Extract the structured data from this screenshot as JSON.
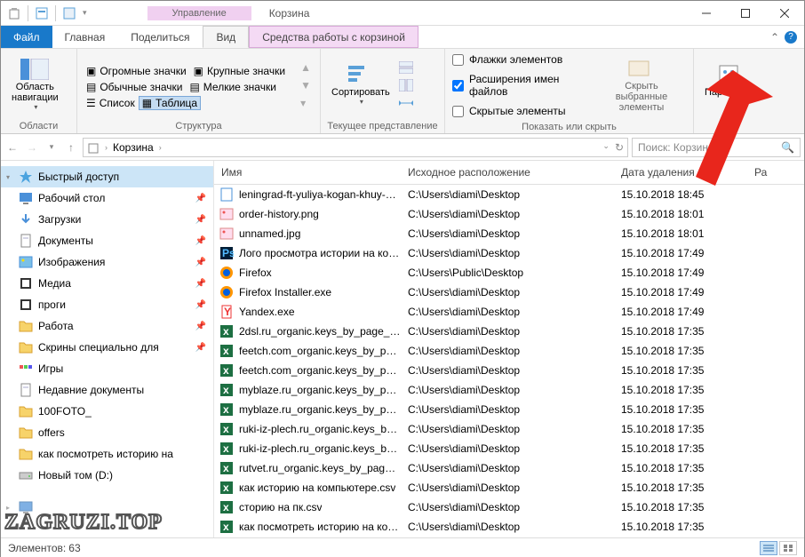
{
  "title": {
    "manage": "Управление",
    "app": "Корзина"
  },
  "tabs": {
    "file": "Файл",
    "home": "Главная",
    "share": "Поделиться",
    "view": "Вид",
    "tools": "Средства работы с корзиной"
  },
  "ribbon": {
    "nav_pane": "Область\nнавигации",
    "nav_group": "Области",
    "icons": {
      "huge": "Огромные значки",
      "large": "Крупные значки",
      "normal": "Обычные значки",
      "small": "Мелкие значки",
      "list": "Список",
      "table": "Таблица"
    },
    "struct_group": "Структура",
    "sort": "Сортировать",
    "view_group": "Текущее представление",
    "checks": {
      "flags": "Флажки элементов",
      "ext": "Расширения имен файлов",
      "hidden": "Скрытые элементы"
    },
    "hide_btn": "Скрыть выбранные\nэлементы",
    "show_group": "Показать или скрыть",
    "params": "Параметры"
  },
  "addr": {
    "root": "Корзина",
    "search_ph": "Поиск: Корзина"
  },
  "columns": {
    "name": "Имя",
    "loc": "Исходное расположение",
    "date": "Дата удаления",
    "r": "Ра"
  },
  "sidebar": {
    "quick": "Быстрый доступ",
    "items": [
      "Рабочий стол",
      "Загрузки",
      "Документы",
      "Изображения",
      "Медиа",
      "проги",
      "Работа",
      "Скрины специально для",
      "Игры",
      "Недавние документы",
      "100FOTO_",
      "offers",
      "как посмотреть историю на",
      "Новый том (D:)"
    ],
    "thispc_ru": "Этот компьютер"
  },
  "files": [
    {
      "ic": "doc",
      "name": "leningrad-ft-yuliya-kogan-khuy-m...",
      "loc": "C:\\Users\\diami\\Desktop",
      "date": "15.10.2018 18:45"
    },
    {
      "ic": "img",
      "name": "order-history.png",
      "loc": "C:\\Users\\diami\\Desktop",
      "date": "15.10.2018 18:01"
    },
    {
      "ic": "img",
      "name": "unnamed.jpg",
      "loc": "C:\\Users\\diami\\Desktop",
      "date": "15.10.2018 18:01"
    },
    {
      "ic": "ps",
      "name": "Лого просмотра истории на ком...",
      "loc": "C:\\Users\\diami\\Desktop",
      "date": "15.10.2018 17:49"
    },
    {
      "ic": "ff",
      "name": "Firefox",
      "loc": "C:\\Users\\Public\\Desktop",
      "date": "15.10.2018 17:49"
    },
    {
      "ic": "ff",
      "name": "Firefox Installer.exe",
      "loc": "C:\\Users\\diami\\Desktop",
      "date": "15.10.2018 17:49"
    },
    {
      "ic": "ya",
      "name": "Yandex.exe",
      "loc": "C:\\Users\\diami\\Desktop",
      "date": "15.10.2018 17:49"
    },
    {
      "ic": "xls",
      "name": "2dsl.ru_organic.keys_by_page_1490...",
      "loc": "C:\\Users\\diami\\Desktop",
      "date": "15.10.2018 17:35"
    },
    {
      "ic": "xls",
      "name": "feetch.com_organic.keys_by_page_...",
      "loc": "C:\\Users\\diami\\Desktop",
      "date": "15.10.2018 17:35"
    },
    {
      "ic": "xls",
      "name": "feetch.com_organic.keys_by_page_...",
      "loc": "C:\\Users\\diami\\Desktop",
      "date": "15.10.2018 17:35"
    },
    {
      "ic": "xls",
      "name": "myblaze.ru_organic.keys_by_page_...",
      "loc": "C:\\Users\\diami\\Desktop",
      "date": "15.10.2018 17:35"
    },
    {
      "ic": "xls",
      "name": "myblaze.ru_organic.keys_by_page_...",
      "loc": "C:\\Users\\diami\\Desktop",
      "date": "15.10.2018 17:35"
    },
    {
      "ic": "xls",
      "name": "ruki-iz-plech.ru_organic.keys_by_p...",
      "loc": "C:\\Users\\diami\\Desktop",
      "date": "15.10.2018 17:35"
    },
    {
      "ic": "xls",
      "name": "ruki-iz-plech.ru_organic.keys_by_p...",
      "loc": "C:\\Users\\diami\\Desktop",
      "date": "15.10.2018 17:35"
    },
    {
      "ic": "xls",
      "name": "rutvet.ru_organic.keys_by_page_16...",
      "loc": "C:\\Users\\diami\\Desktop",
      "date": "15.10.2018 17:35"
    },
    {
      "ic": "xls",
      "name": "как историю на компьютере.csv",
      "loc": "C:\\Users\\diami\\Desktop",
      "date": "15.10.2018 17:35"
    },
    {
      "ic": "xls",
      "name": "сторию на пк.csv",
      "loc": "C:\\Users\\diami\\Desktop",
      "date": "15.10.2018 17:35"
    },
    {
      "ic": "xls",
      "name": "как посмотреть историю на ком...",
      "loc": "C:\\Users\\diami\\Desktop",
      "date": "15.10.2018 17:35"
    }
  ],
  "status": {
    "count_label": "Элементов:",
    "count": "63"
  },
  "watermark": "ZAGRUZI.TOP"
}
